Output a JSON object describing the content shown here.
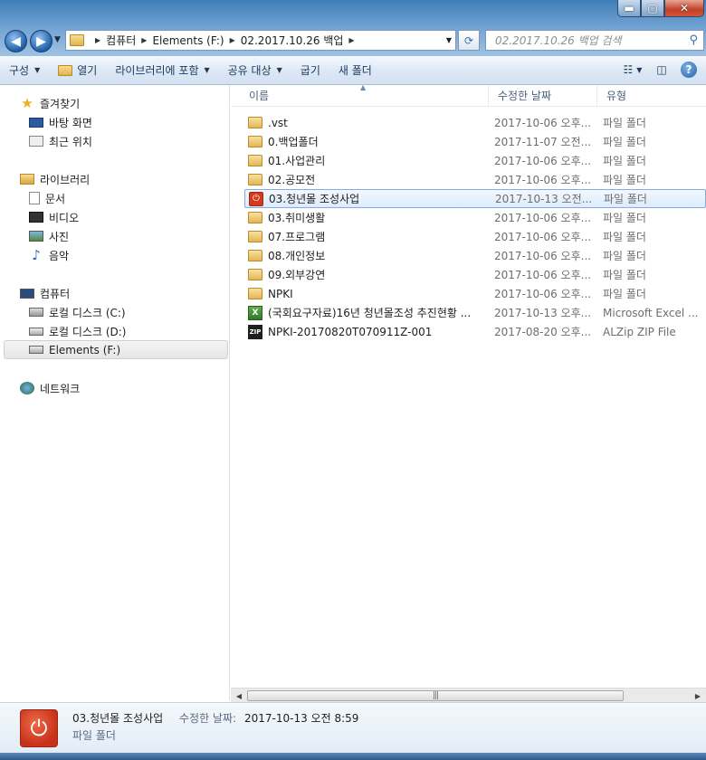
{
  "window": {
    "min_glyph": "▬",
    "max_glyph": "▢",
    "close_glyph": "✕"
  },
  "address": {
    "crumbs": [
      "컴퓨터",
      "Elements (F:)",
      "02.2017.10.26 백업"
    ]
  },
  "search": {
    "placeholder": "02.2017.10.26 백업 검색"
  },
  "toolbar": {
    "organize": "구성",
    "open": "열기",
    "include_library": "라이브러리에 포함",
    "share": "공유 대상",
    "burn": "굽기",
    "new_folder": "새 폴더"
  },
  "nav": {
    "favorites": "즐겨찾기",
    "desktop": "바탕 화면",
    "recent": "최근 위치",
    "libraries": "라이브러리",
    "documents": "문서",
    "videos": "비디오",
    "pictures": "사진",
    "music": "음악",
    "computer": "컴퓨터",
    "disk_c": "로컬 디스크 (C:)",
    "disk_d": "로컬 디스크 (D:)",
    "disk_f": "Elements (F:)",
    "network": "네트워크"
  },
  "columns": {
    "name": "이름",
    "date": "수정한 날짜",
    "type": "유형"
  },
  "files": [
    {
      "name": ".vst",
      "date": "2017-10-06 오후...",
      "type": "파일 폴더",
      "icon": "folder"
    },
    {
      "name": "0.백업폴더",
      "date": "2017-11-07 오전...",
      "type": "파일 폴더",
      "icon": "folder"
    },
    {
      "name": "01.사업관리",
      "date": "2017-10-06 오후...",
      "type": "파일 폴더",
      "icon": "folder"
    },
    {
      "name": "02.공모전",
      "date": "2017-10-06 오후...",
      "type": "파일 폴더",
      "icon": "folder"
    },
    {
      "name": "03.청년몰 조성사업",
      "date": "2017-10-13 오전...",
      "type": "파일 폴더",
      "icon": "power"
    },
    {
      "name": "03.취미생활",
      "date": "2017-10-06 오후...",
      "type": "파일 폴더",
      "icon": "folder"
    },
    {
      "name": "07.프로그램",
      "date": "2017-10-06 오후...",
      "type": "파일 폴더",
      "icon": "folder"
    },
    {
      "name": "08.개인정보",
      "date": "2017-10-06 오후...",
      "type": "파일 폴더",
      "icon": "folder"
    },
    {
      "name": "09.외부강연",
      "date": "2017-10-06 오후...",
      "type": "파일 폴더",
      "icon": "folder"
    },
    {
      "name": "NPKI",
      "date": "2017-10-06 오후...",
      "type": "파일 폴더",
      "icon": "folder"
    },
    {
      "name": "(국회요구자료)16년 청년몰조성 추진현황 ...",
      "date": "2017-10-13 오후...",
      "type": "Microsoft Excel ...",
      "icon": "excel"
    },
    {
      "name": "NPKI-20170820T070911Z-001",
      "date": "2017-08-20 오후...",
      "type": "ALZip ZIP File",
      "icon": "zip"
    }
  ],
  "details": {
    "name": "03.청년몰 조성사업",
    "modified_label": "수정한 날짜:",
    "modified_value": "2017-10-13 오전 8:59",
    "type": "파일 폴더"
  },
  "icon_glyphs": {
    "excel": "X",
    "zip": "ZIP",
    "power": "⏻"
  }
}
